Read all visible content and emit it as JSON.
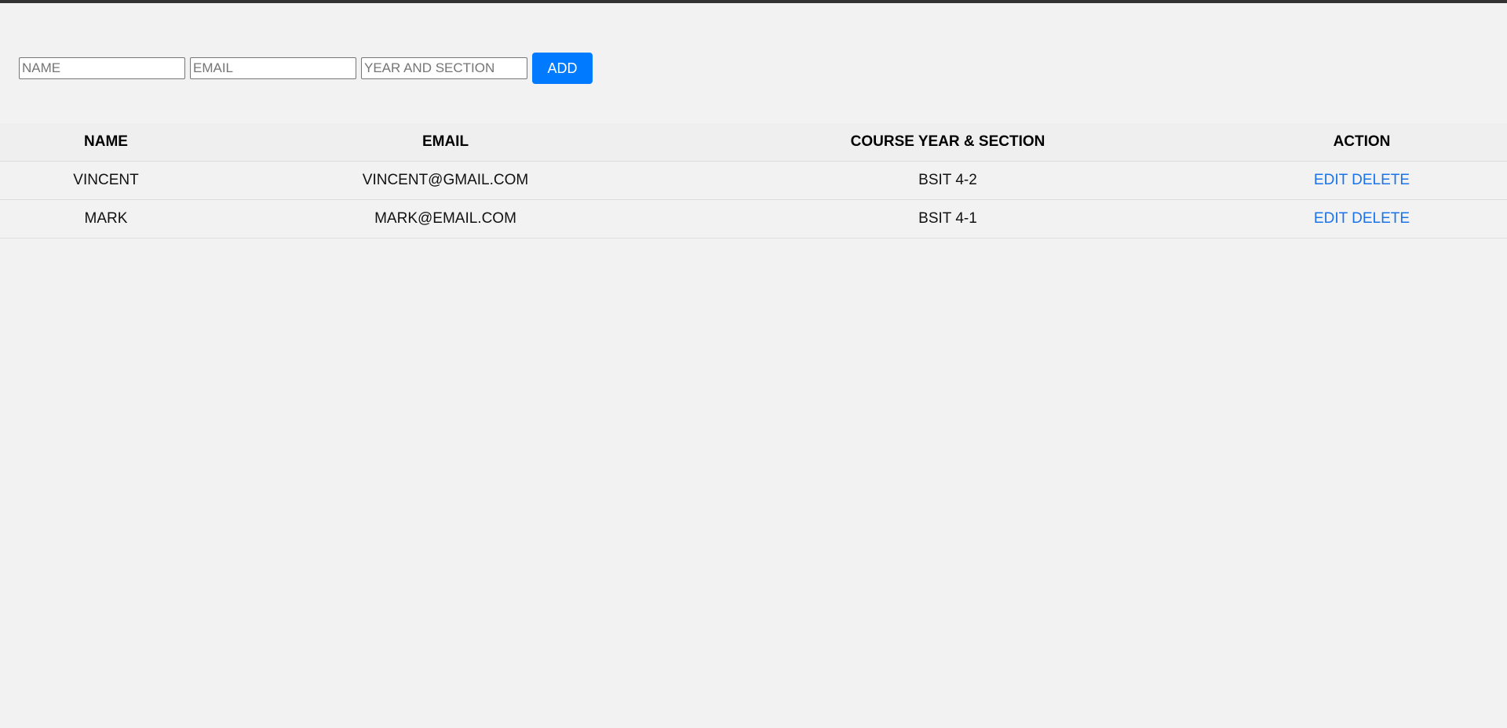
{
  "form": {
    "name_placeholder": "NAME",
    "email_placeholder": "EMAIL",
    "section_placeholder": "YEAR AND SECTION",
    "add_label": "ADD"
  },
  "table": {
    "headers": {
      "name": "NAME",
      "email": "EMAIL",
      "course": "COURSE YEAR & SECTION",
      "action": "ACTION"
    },
    "rows": [
      {
        "name": "VINCENT",
        "email": "VINCENT@GMAIL.COM",
        "course": "BSIT 4-2",
        "edit": "EDIT",
        "delete": "DELETE"
      },
      {
        "name": "MARK",
        "email": "MARK@EMAIL.COM",
        "course": "BSIT 4-1",
        "edit": "EDIT",
        "delete": "DELETE"
      }
    ]
  },
  "colors": {
    "background": "#f2f2f2",
    "accent": "#007bff",
    "link": "#1a73e8",
    "top_bar": "#333333"
  }
}
